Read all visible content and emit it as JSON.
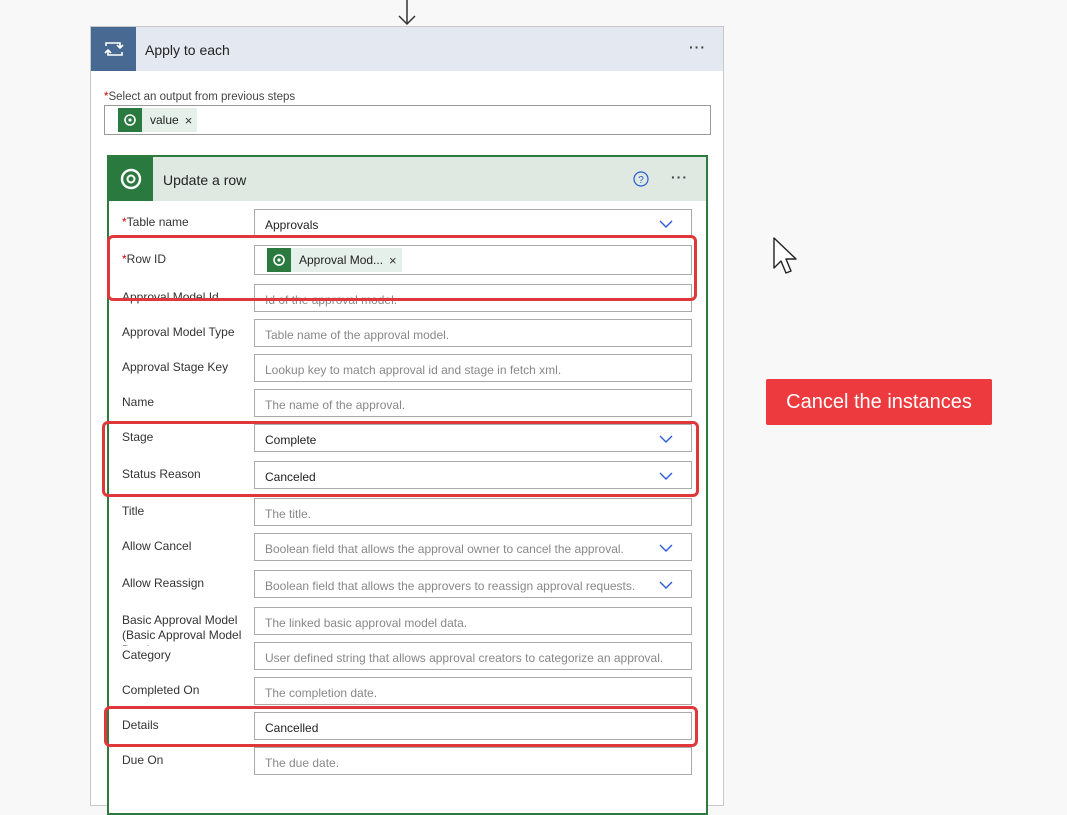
{
  "apply_each": {
    "title": "Apply to each",
    "select_label": "Select an output from previous steps",
    "token_value": "value"
  },
  "update_row": {
    "title": "Update a row",
    "fields": [
      {
        "label": "Table name",
        "value": "Approvals",
        "required": true
      },
      {
        "label": "Row ID",
        "token": "Approval Mod...",
        "required": true
      },
      {
        "label": "Approval Model Id",
        "placeholder": "Id of the approval model."
      },
      {
        "label": "Approval Model Type",
        "placeholder": "Table name of the approval model."
      },
      {
        "label": "Approval Stage Key",
        "placeholder": "Lookup key to match approval id and stage in fetch xml."
      },
      {
        "label": "Name",
        "placeholder": "The name of the approval."
      },
      {
        "label": "Stage",
        "value": "Complete"
      },
      {
        "label": "Status Reason",
        "value": "Canceled"
      },
      {
        "label": "Title",
        "placeholder": "The title."
      },
      {
        "label": "Allow Cancel",
        "placeholder": "Boolean field that allows the approval owner to cancel the approval."
      },
      {
        "label": "Allow Reassign",
        "placeholder": "Boolean field that allows the approvers to reassign approval requests."
      },
      {
        "label": "Basic Approval Model (Basic Approval Model Data)",
        "placeholder": "The linked basic approval model data."
      },
      {
        "label": "Category",
        "placeholder": "User defined string that allows approval creators to categorize an approval."
      },
      {
        "label": "Completed On",
        "placeholder": "The completion date."
      },
      {
        "label": "Details",
        "value": "Cancelled"
      },
      {
        "label": "Due On",
        "placeholder": "The due date."
      }
    ]
  },
  "callout": {
    "text": "Cancel the instances"
  },
  "colors": {
    "highlight": "#e0383a",
    "callout_bg": "#ec3a3e",
    "dataverse_green": "#2a7a3f",
    "loop_blue": "#486991"
  },
  "icons": [
    "arrow-down-icon",
    "loop-icon",
    "more-icon",
    "dataverse-icon",
    "close-icon",
    "help-icon",
    "chevron-down-icon",
    "cursor-icon"
  ]
}
